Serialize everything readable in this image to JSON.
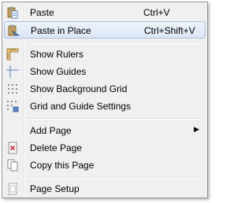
{
  "menu": {
    "items": [
      {
        "label": "Paste",
        "shortcut": "Ctrl+V",
        "icon": "paste-icon"
      },
      {
        "label": "Paste in Place",
        "shortcut": "Ctrl+Shift+V",
        "icon": "paste-in-place-icon",
        "highlighted": true
      },
      {
        "label": "Show Rulers",
        "icon": "rulers-icon"
      },
      {
        "label": "Show Guides",
        "icon": "guides-icon"
      },
      {
        "label": "Show Background Grid",
        "icon": "grid-icon"
      },
      {
        "label": "Grid and Guide Settings",
        "icon": "grid-settings-icon"
      },
      {
        "label": "Add Page",
        "submenu": true
      },
      {
        "label": "Delete Page",
        "icon": "delete-page-icon"
      },
      {
        "label": "Copy this Page",
        "icon": "copy-page-icon"
      },
      {
        "label": "Page Setup",
        "icon": "page-setup-icon"
      }
    ]
  },
  "colors": {
    "menu_background": "#f0f0f0",
    "highlight_border": "#a8bfe0",
    "icon_blue": "#5a86c4",
    "icon_tan": "#d6a24a",
    "delete_red": "#d03030"
  }
}
